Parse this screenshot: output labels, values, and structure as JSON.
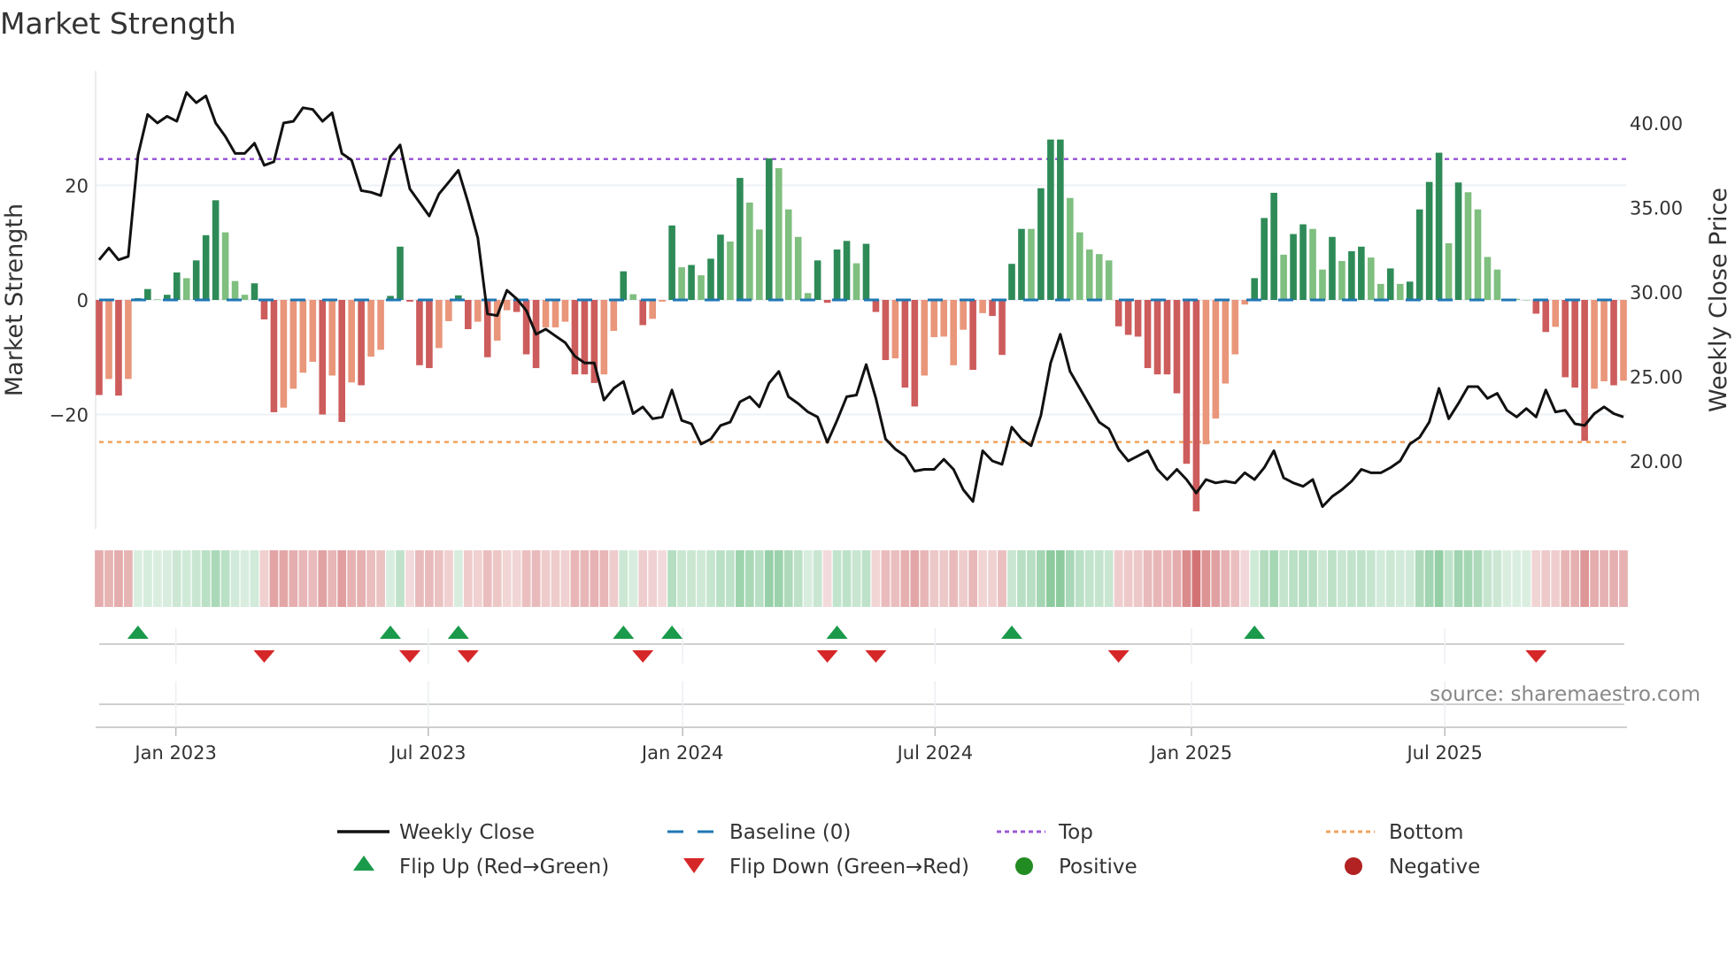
{
  "chart_data": {
    "type": "bar",
    "title": "Market Strength",
    "ylabel": "Market Strength",
    "y2label": "Weekly Close Price",
    "ylim": [
      -40,
      40
    ],
    "y2lim": [
      16,
      43
    ],
    "yticks": [
      {
        "v": 20,
        "label": "20"
      },
      {
        "v": 0,
        "label": "0"
      },
      {
        "v": -20,
        "label": "−20"
      }
    ],
    "y2ticks": [
      {
        "v": 40,
        "label": "40.00"
      },
      {
        "v": 35,
        "label": "35.00"
      },
      {
        "v": 30,
        "label": "30.00"
      },
      {
        "v": 25,
        "label": "25.00"
      },
      {
        "v": 20,
        "label": "20.00"
      }
    ],
    "xticks": [
      {
        "week": 7.9,
        "label": "Jan 2023"
      },
      {
        "week": 33.9,
        "label": "Jul 2023"
      },
      {
        "week": 60.1,
        "label": "Jan 2024"
      },
      {
        "week": 86.1,
        "label": "Jul 2024"
      },
      {
        "week": 112.5,
        "label": "Jan 2025"
      },
      {
        "week": 138.6,
        "label": "Jul 2025"
      }
    ],
    "top_level": 24.6,
    "bottom_level": -24.8,
    "strength": [
      -16.6,
      -13.8,
      -16.7,
      -13.8,
      0.3,
      1.9,
      0.1,
      0.9,
      4.8,
      3.8,
      6.9,
      11.3,
      17.4,
      11.8,
      3.3,
      0.9,
      2.9,
      -3.4,
      -19.6,
      -18.8,
      -15.5,
      -12.7,
      -10.8,
      -20,
      -13.2,
      -21.3,
      -14.4,
      -14.9,
      -9.9,
      -8.7,
      0.7,
      9.3,
      -0.3,
      -11.4,
      -11.9,
      -8.4,
      -3.7,
      0.8,
      -5.1,
      -3.8,
      -10,
      -7.1,
      -1.8,
      -2.1,
      -9.5,
      -11.9,
      -4.8,
      -4.8,
      -3.8,
      -13,
      -13,
      -14.5,
      -13,
      -5.4,
      5,
      1,
      -4.4,
      -3.3,
      -0.3,
      13,
      5.7,
      6.1,
      4.3,
      7.2,
      11.4,
      10.2,
      21.3,
      17,
      12.3,
      24.7,
      23,
      15.8,
      11,
      1.2,
      6.9,
      -0.5,
      8.8,
      10.3,
      6.4,
      9.8,
      -2.1,
      -10.5,
      -10.2,
      -15.3,
      -18.6,
      -13.2,
      -6.5,
      -6.4,
      -11.4,
      -5.2,
      -12.2,
      -2.3,
      -2.8,
      -9.6,
      6.3,
      12.4,
      12.4,
      19.5,
      28,
      28,
      17.8,
      11.8,
      8.8,
      8,
      6.9,
      -4.6,
      -6.1,
      -6.4,
      -11.9,
      -13,
      -13,
      -16.3,
      -28.6,
      -36.9,
      -25.2,
      -20.7,
      -14.6,
      -9.5,
      -0.8,
      3.8,
      14.3,
      18.7,
      7.9,
      11.5,
      13.2,
      12.4,
      5.3,
      11,
      6.8,
      8.5,
      9.3,
      7.4,
      2.8,
      5.5,
      2.8,
      3.2,
      15.8,
      20.6,
      25.7,
      9.9,
      20.5,
      18.8,
      15.8,
      7.5,
      5.3,
      0,
      0.2,
      0,
      -2.4,
      -5.6,
      -4.7,
      -13.5,
      -15.3,
      -24.6,
      -15.5,
      -14.2,
      -14.9,
      -14.1
    ],
    "tone": "DLDLDDLDDLDDDLLLDDDLLLLDLDLDLLDDDDDLLDDLDLLDDDLLLDDDLLDLDLLDLDLDDLDLLDLLLLDDDDLDDDLDDLLLLLDLDDDDLDDDLLLLLDDDDDDDDDLLLLLDDDLDDLLDLDDLLDLDDDDLDLLLLLLLDDLDDDLLDL",
    "weekly_close": [
      31.9,
      32.6,
      31.9,
      32.1,
      38.1,
      40.5,
      40.0,
      40.4,
      40.1,
      41.8,
      41.2,
      41.6,
      40.0,
      39.2,
      38.2,
      38.2,
      38.8,
      37.5,
      37.7,
      40.0,
      40.1,
      40.9,
      40.8,
      40.1,
      40.6,
      38.2,
      37.8,
      36.0,
      35.9,
      35.7,
      38.0,
      38.7,
      36.1,
      35.3,
      34.5,
      35.8,
      36.5,
      37.2,
      35.3,
      33.2,
      28.7,
      28.6,
      30.1,
      29.6,
      28.9,
      27.5,
      27.8,
      27.4,
      27.0,
      26.2,
      25.8,
      25.8,
      23.6,
      24.3,
      24.7,
      22.8,
      23.2,
      22.5,
      22.6,
      24.2,
      22.4,
      22.2,
      21.0,
      21.3,
      22.1,
      22.3,
      23.5,
      23.8,
      23.2,
      24.6,
      25.3,
      23.8,
      23.4,
      22.9,
      22.6,
      21.1,
      22.4,
      23.8,
      23.9,
      25.7,
      23.7,
      21.3,
      20.7,
      20.3,
      19.4,
      19.5,
      19.5,
      20.1,
      19.5,
      18.3,
      17.6,
      20.6,
      20.0,
      19.8,
      22.0,
      21.3,
      20.9,
      22.7,
      25.8,
      27.5,
      25.3,
      24.3,
      23.3,
      22.3,
      21.9,
      20.7,
      20.0,
      20.3,
      20.6,
      19.5,
      18.9,
      19.5,
      18.9,
      18.1,
      18.9,
      18.7,
      18.8,
      18.7,
      19.3,
      18.9,
      19.6,
      20.6,
      19.0,
      18.7,
      18.5,
      18.9,
      17.3,
      17.9,
      18.3,
      18.8,
      19.5,
      19.3,
      19.3,
      19.6,
      20.0,
      21.0,
      21.4,
      22.3,
      24.3,
      22.5,
      23.4,
      24.4,
      24.4,
      23.7,
      24.0,
      23.0,
      22.6,
      23.1,
      22.6,
      24.2,
      22.9,
      23.0,
      22.2,
      22.1,
      22.8,
      23.2,
      22.8,
      22.6
    ],
    "flip_up_weeks": [
      4,
      30,
      37,
      54,
      59,
      76,
      94,
      119
    ],
    "flip_down_weeks": [
      17,
      32,
      38,
      56,
      75,
      80,
      105,
      148
    ],
    "colors": {
      "strong_positive": "#2e8b57",
      "weak_positive": "#7fbf7f",
      "strong_negative": "#cd5c5c",
      "weak_negative": "#e9967a",
      "price": "#111111",
      "baseline": "#1f77b4",
      "top": "#9b59d6",
      "bottom": "#f0a35e",
      "flip_up": "#1a9a4a",
      "flip_down": "#d62728",
      "positive": "#228b22",
      "negative": "#b22222"
    },
    "legend": {
      "position": "bottom",
      "items": [
        {
          "label": "Weekly Close"
        },
        {
          "label": "Baseline (0)"
        },
        {
          "label": "Top"
        },
        {
          "label": "Bottom"
        },
        {
          "label": "Flip Up (Red→Green)"
        },
        {
          "label": "Flip Down (Green→Red)"
        },
        {
          "label": "Positive"
        },
        {
          "label": "Negative"
        }
      ]
    },
    "source": "source: sharemaestro.com"
  }
}
